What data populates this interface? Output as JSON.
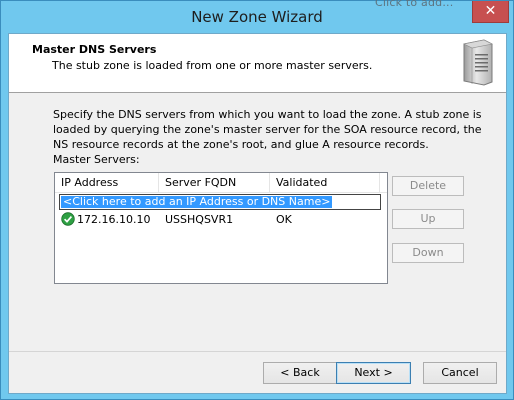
{
  "window": {
    "title": "New Zone Wizard",
    "background_text": "Click to add...",
    "close_symbol": "✕"
  },
  "header": {
    "title": "Master DNS Servers",
    "subtitle": "The stub zone is loaded from one or more master servers.",
    "icon": "server-icon"
  },
  "body": {
    "description": "Specify the DNS servers from which you want to load the zone. A stub zone is loaded by querying the zone's master server for the SOA resource record, the NS resource records at the zone's root, and glue A resource records.",
    "list_label": "Master Servers:"
  },
  "list": {
    "columns": [
      "IP Address",
      "Server FQDN",
      "Validated"
    ],
    "add_prompt": "<Click here to add an IP Address or DNS Name>",
    "rows": [
      {
        "ip": "172.16.10.10",
        "fqdn": "USSHQSVR1",
        "validated": "OK",
        "status_icon": "ok-check-icon"
      }
    ]
  },
  "side_buttons": {
    "delete": "Delete",
    "up": "Up",
    "down": "Down"
  },
  "footer": {
    "back": "< Back",
    "next": "Next >",
    "cancel": "Cancel"
  },
  "colors": {
    "window_frame": "#70c8ee",
    "selection": "#3399ff",
    "close_button": "#c75050",
    "ok_icon": "#2ea043"
  }
}
